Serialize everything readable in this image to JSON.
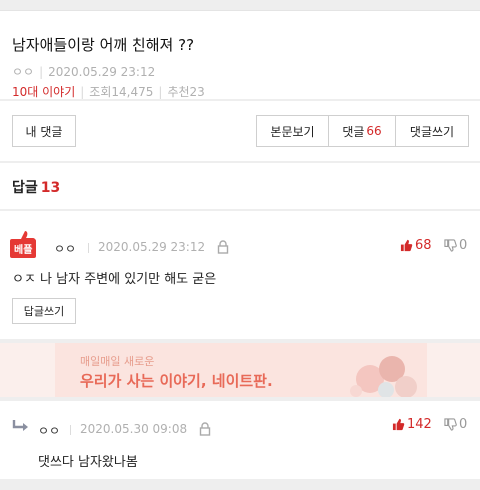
{
  "post": {
    "title": "남자애들이랑 어깨 친해져 ??",
    "author": "ㅇㅇ",
    "datetime": "2020.05.29 23:12",
    "category": "10대 이야기",
    "views_label": "조회",
    "views": "14,475",
    "recommend_label": "추천",
    "recommend": "23"
  },
  "buttons": {
    "my_comments": "내 댓글",
    "view_body": "본문보기",
    "comments_label": "댓글",
    "comments_count": "66",
    "write_comment": "댓글쓰기"
  },
  "replies": {
    "label": "답글",
    "count": "13"
  },
  "comments": [
    {
      "badge": "베플",
      "author": "ㅇㅇ",
      "datetime": "2020.05.29 23:12",
      "up": "68",
      "down": "0",
      "text": "ㅇㅈ 나 남자 주변에 있기만 해도 굳은",
      "reply_button": "답글쓰기"
    },
    {
      "author": "ㅇㅇ",
      "datetime": "2020.05.30 09:08",
      "up": "142",
      "down": "0",
      "text": "댓쓰다 남자왔나봄"
    }
  ],
  "ad": {
    "small": "매일매일 새로운",
    "big": "우리가 사는 이야기, 네이트판."
  },
  "colors": {
    "accent": "#d32a2a",
    "badge": "#e53935",
    "ad_text": "#e86a58",
    "ad_bg": "#fbe4df"
  }
}
